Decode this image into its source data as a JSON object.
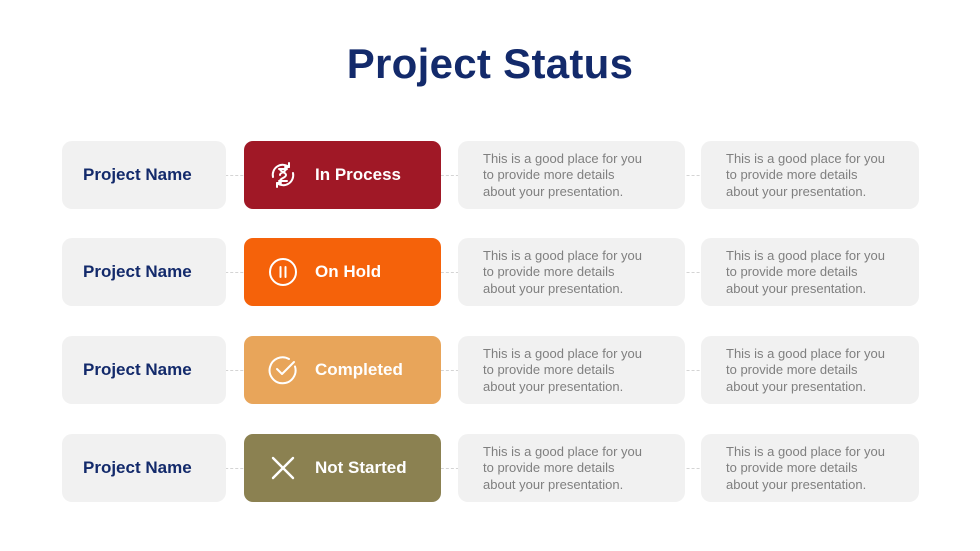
{
  "title": "Project Status",
  "colors": {
    "title": "#132a6b",
    "in_process": "#a01826",
    "on_hold": "#f5620a",
    "completed": "#e8a55a",
    "not_started": "#8b8151",
    "card_bg": "#f1f1f1",
    "desc_text": "#7f7f7f"
  },
  "rows": [
    {
      "project_name": "Project Name",
      "status": {
        "label": "In Process",
        "icon": "hourglass-refresh-icon"
      },
      "details": [
        [
          "This is a good place for you",
          "to provide more details",
          "about your presentation."
        ],
        [
          "This is a good place for you",
          "to provide more details",
          "about your presentation."
        ]
      ]
    },
    {
      "project_name": "Project Name",
      "status": {
        "label": "On Hold",
        "icon": "pause-icon"
      },
      "details": [
        [
          "This is a good place for you",
          "to provide more details",
          "about your presentation."
        ],
        [
          "This is a good place for you",
          "to provide more details",
          "about your presentation."
        ]
      ]
    },
    {
      "project_name": "Project Name",
      "status": {
        "label": "Completed",
        "icon": "check-circle-icon"
      },
      "details": [
        [
          "This is a good place for you",
          "to provide more details",
          "about your presentation."
        ],
        [
          "This is a good place for you",
          "to provide more details",
          "about your presentation."
        ]
      ]
    },
    {
      "project_name": "Project Name",
      "status": {
        "label": "Not Started",
        "icon": "x-icon"
      },
      "details": [
        [
          "This is a good place for you",
          "to provide more details",
          "about your presentation."
        ],
        [
          "This is a good place for you",
          "to provide more details",
          "about your presentation."
        ]
      ]
    }
  ]
}
